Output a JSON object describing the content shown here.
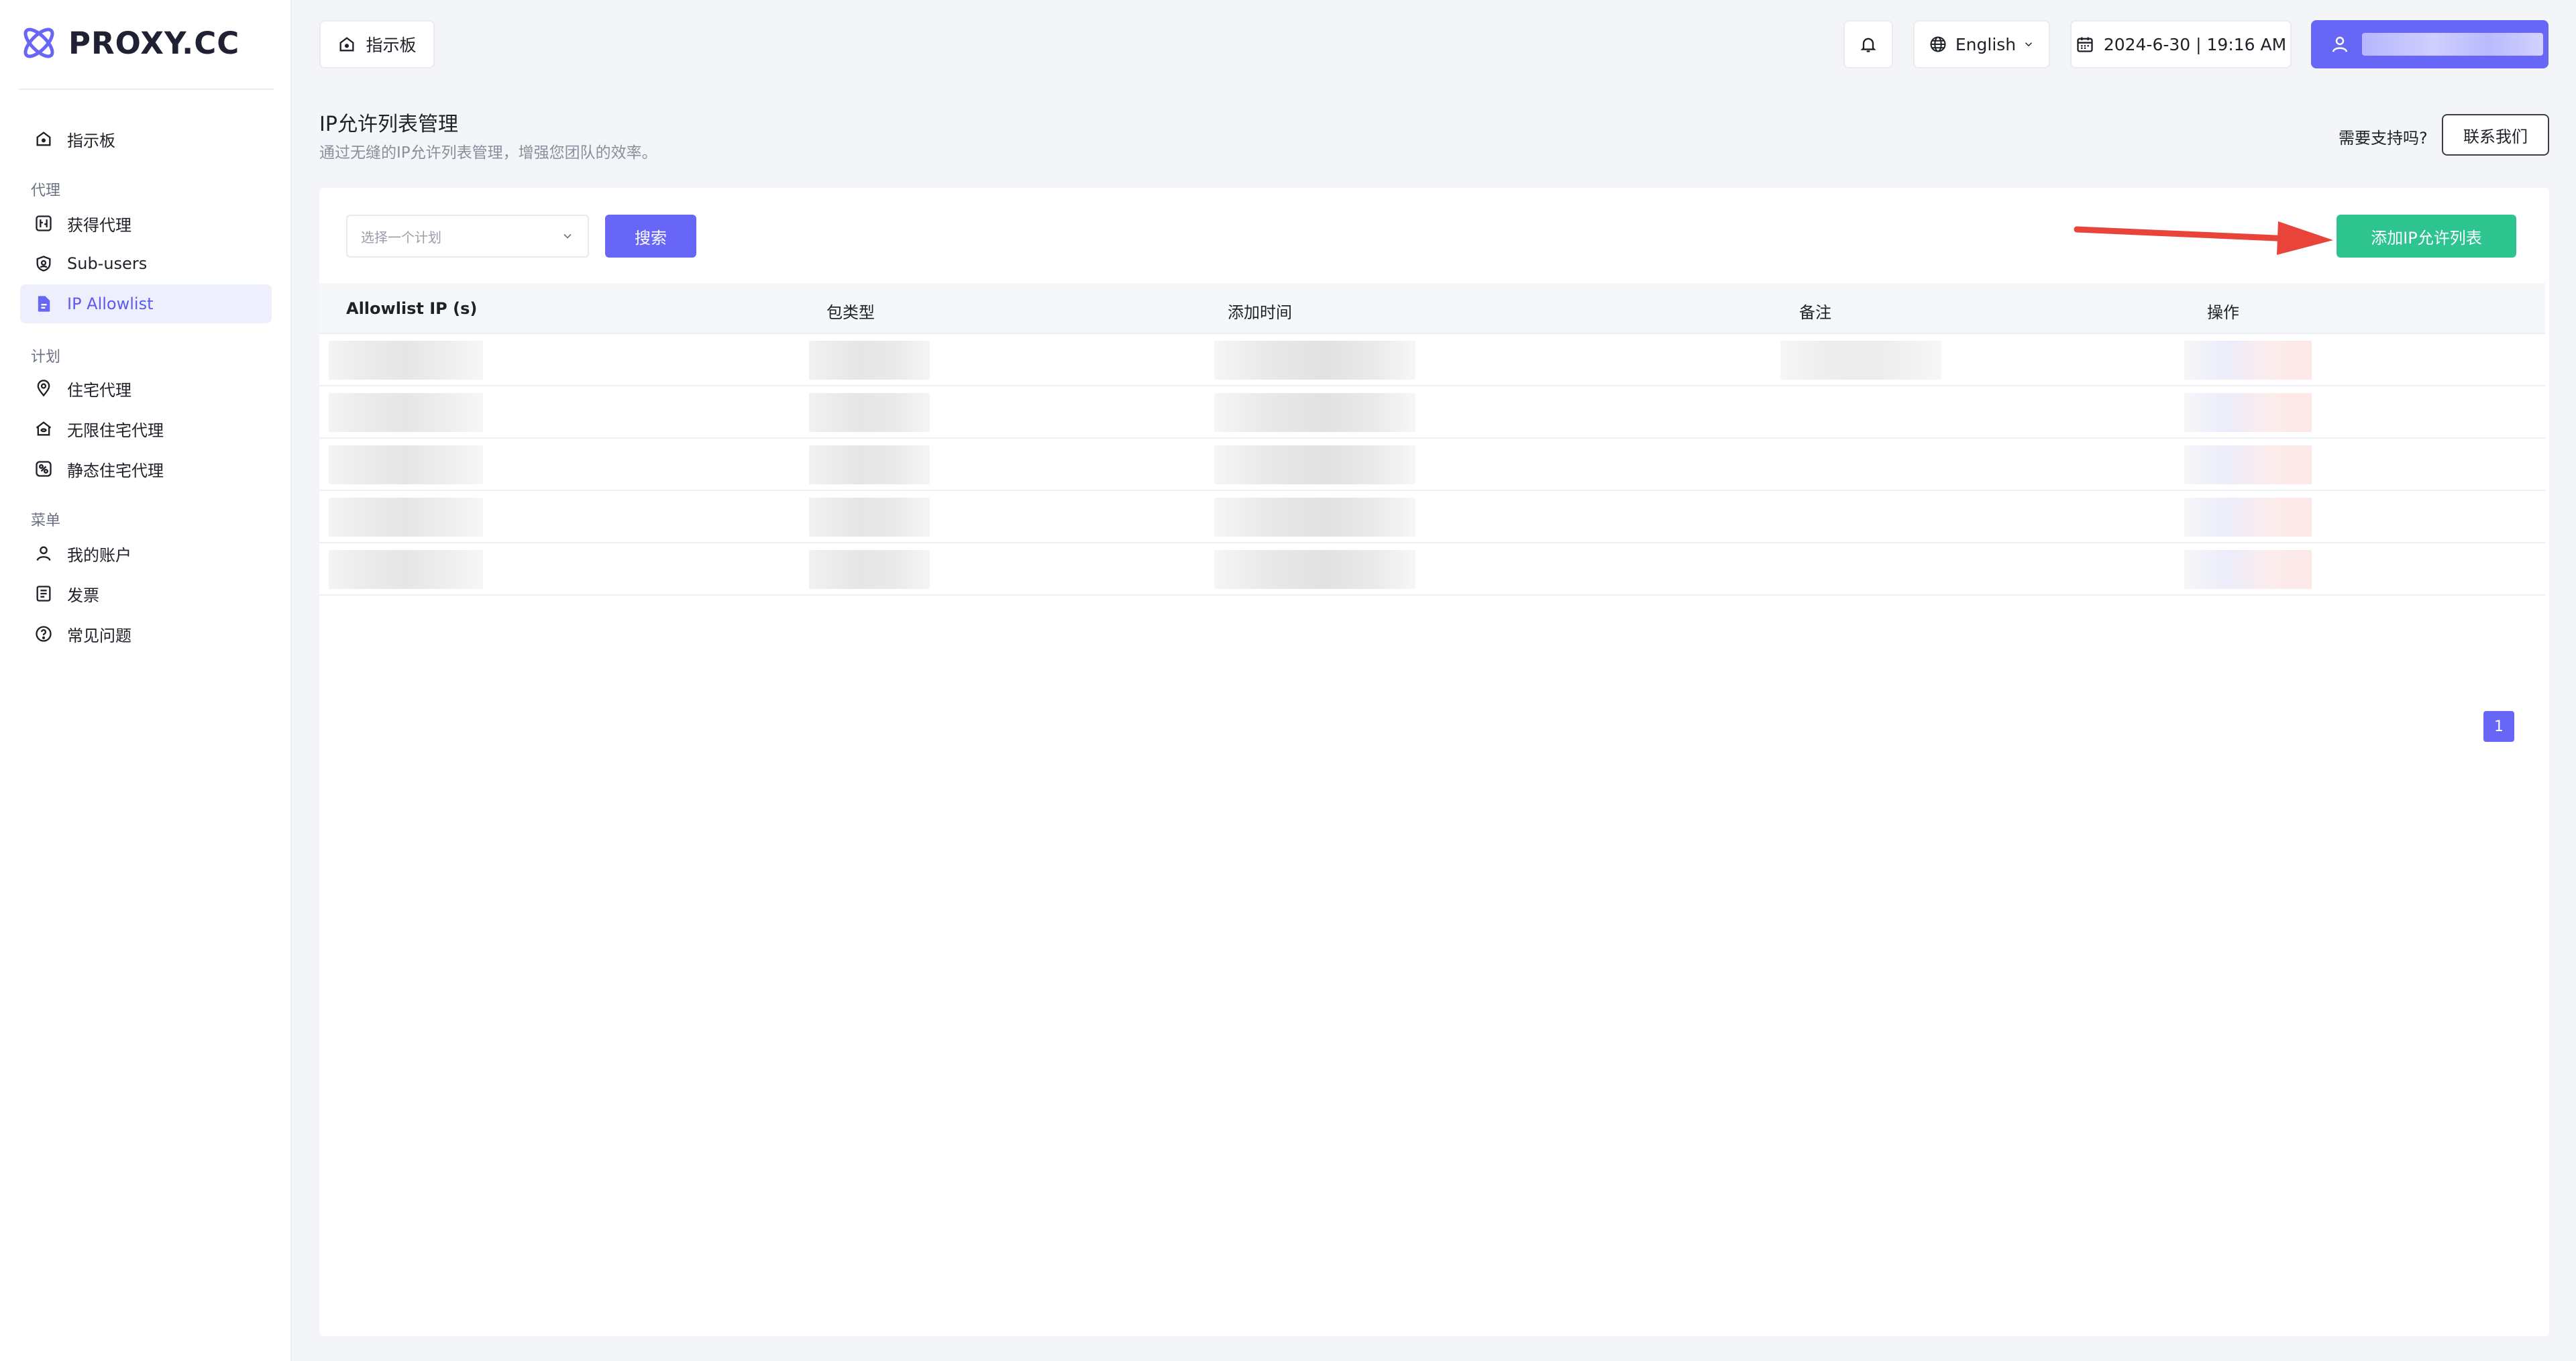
{
  "brand": {
    "name": "PROXY.CC",
    "accent": "#6766f6"
  },
  "sidebar": {
    "items": [
      {
        "label": "指示板",
        "icon": "home-icon"
      }
    ],
    "sections": [
      {
        "title": "代理",
        "items": [
          {
            "label": "获得代理",
            "icon": "proxy-icon"
          },
          {
            "label": "Sub-users",
            "icon": "shield-user-icon"
          },
          {
            "label": "IP Allowlist",
            "icon": "document-icon",
            "active": true
          }
        ]
      },
      {
        "title": "计划",
        "items": [
          {
            "label": "住宅代理",
            "icon": "location-pin-icon"
          },
          {
            "label": "无限住宅代理",
            "icon": "house-icon"
          },
          {
            "label": "静态住宅代理",
            "icon": "static-proxy-icon"
          }
        ]
      },
      {
        "title": "菜单",
        "items": [
          {
            "label": "我的账户",
            "icon": "user-icon"
          },
          {
            "label": "发票",
            "icon": "invoice-icon"
          },
          {
            "label": "常见问题",
            "icon": "help-circle-icon"
          }
        ]
      }
    ]
  },
  "topbar": {
    "breadcrumb": "指示板",
    "language": "English",
    "datetime": "2024-6-30 | 19:16 AM"
  },
  "header": {
    "title": "IP允许列表管理",
    "subtitle": "通过无缝的IP允许列表管理，增强您团队的效率。",
    "help_text": "需要支持吗?",
    "contact_label": "联系我们"
  },
  "toolbar": {
    "plan_placeholder": "选择一个计划",
    "search_label": "搜索",
    "add_label": "添加IP允许列表",
    "add_color": "#2ec48f"
  },
  "table": {
    "columns": [
      "Allowlist IP (s)",
      "包类型",
      "添加时间",
      "备注",
      "操作"
    ]
  },
  "pagination": {
    "current": "1"
  }
}
